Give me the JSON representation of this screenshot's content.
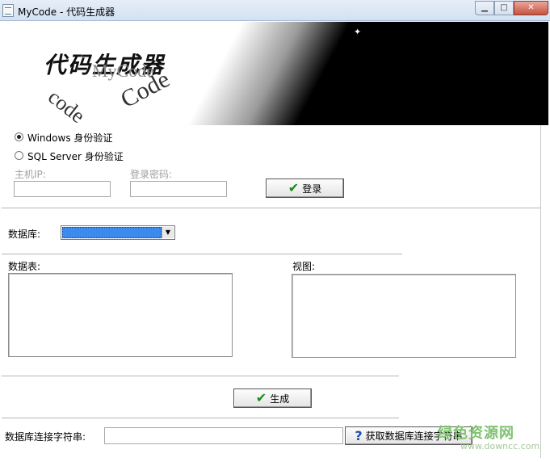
{
  "window": {
    "title": "MyCode - 代码生成器",
    "min_glyph": "▁",
    "max_glyph": "□",
    "close_glyph": "✕"
  },
  "banner": {
    "logo_cn": "代码生成器",
    "logo_mycode": "MyCode",
    "logo_code_small": "code",
    "logo_code_large": "Code"
  },
  "auth": {
    "windows_auth_label": "Windows 身份验证",
    "sql_auth_label": "SQL Server 身份验证",
    "selected": "windows",
    "host_ip_label": "主机IP:",
    "host_ip_value": "",
    "password_label": "登录密码:",
    "password_value": "",
    "login_button": "登录"
  },
  "database": {
    "label": "数据库:",
    "selected_value": ""
  },
  "lists": {
    "tables_label": "数据表:",
    "views_label": "视图:"
  },
  "actions": {
    "generate_button": "生成"
  },
  "connection": {
    "label": "数据库连接字符串:",
    "value": "",
    "get_button": "获取数据库连接字符串"
  },
  "watermark": {
    "cn": "绿色资源网",
    "url": "www.downcc.com"
  },
  "icons": {
    "check": "✔",
    "help": "?",
    "combo_arrow": "▼",
    "sparkle": "✦"
  }
}
